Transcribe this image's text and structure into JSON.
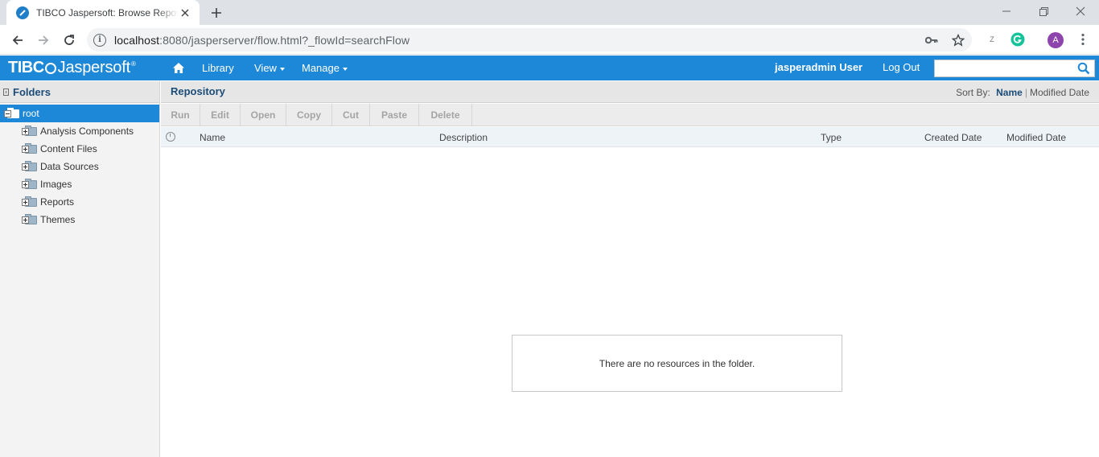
{
  "browser": {
    "tab_title": "TIBCO Jaspersoft: Browse Repository",
    "new_tab_symbol": "+",
    "url_host": "localhost",
    "url_rest": ":8080/jasperserver/flow.html?_flowId=searchFlow",
    "info_symbol": "i",
    "extension_z": "Z",
    "profile_initial": "A",
    "grammarly_color": "#15c39a",
    "profile_color": "#8e44ad"
  },
  "app_header": {
    "logo_tibco": "TIBC",
    "logo_jaspersoft": "Jaspersoft",
    "logo_tm": "®",
    "menu": [
      {
        "label": "Library"
      },
      {
        "label": "View"
      },
      {
        "label": "Manage"
      }
    ],
    "user": "jasperadmin User",
    "logout": "Log Out",
    "search_value": "",
    "accent_color": "#1e88d8"
  },
  "folders_panel": {
    "title": "Folders",
    "root": "root",
    "items": [
      {
        "label": "Analysis Components"
      },
      {
        "label": "Content Files"
      },
      {
        "label": "Data Sources"
      },
      {
        "label": "Images"
      },
      {
        "label": "Reports"
      },
      {
        "label": "Themes"
      }
    ]
  },
  "repository": {
    "title": "Repository",
    "sort_label": "Sort By:",
    "sort_active": "Name",
    "sort_other": "Modified Date",
    "actions": [
      {
        "label": "Run"
      },
      {
        "label": "Edit"
      },
      {
        "label": "Open"
      },
      {
        "label": "Copy"
      },
      {
        "label": "Cut"
      },
      {
        "label": "Paste"
      },
      {
        "label": "Delete"
      }
    ],
    "columns": {
      "name": "Name",
      "description": "Description",
      "type": "Type",
      "created": "Created Date",
      "modified": "Modified Date"
    },
    "empty_message": "There are no resources in the folder."
  }
}
